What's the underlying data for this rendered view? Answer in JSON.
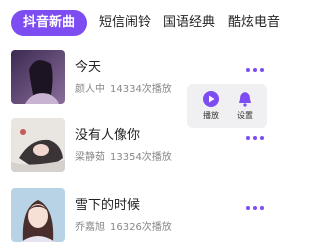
{
  "tabs": [
    {
      "label": "抖音新曲",
      "active": true
    },
    {
      "label": "短信闹铃",
      "active": false
    },
    {
      "label": "国语经典",
      "active": false
    },
    {
      "label": "酷炫电音",
      "active": false
    }
  ],
  "songs": [
    {
      "title": "今天",
      "artist": "颜人中",
      "plays": "14334次播放"
    },
    {
      "title": "没有人像你",
      "artist": "梁静茹",
      "plays": "13354次播放"
    },
    {
      "title": "雪下的时候",
      "artist": "乔嘉旭",
      "plays": "16326次播放"
    }
  ],
  "popup": {
    "play_label": "播放",
    "set_label": "设置"
  },
  "colors": {
    "accent": "#7d4df2",
    "popup_bg": "#f0f0f2",
    "meta_text": "#888888"
  }
}
